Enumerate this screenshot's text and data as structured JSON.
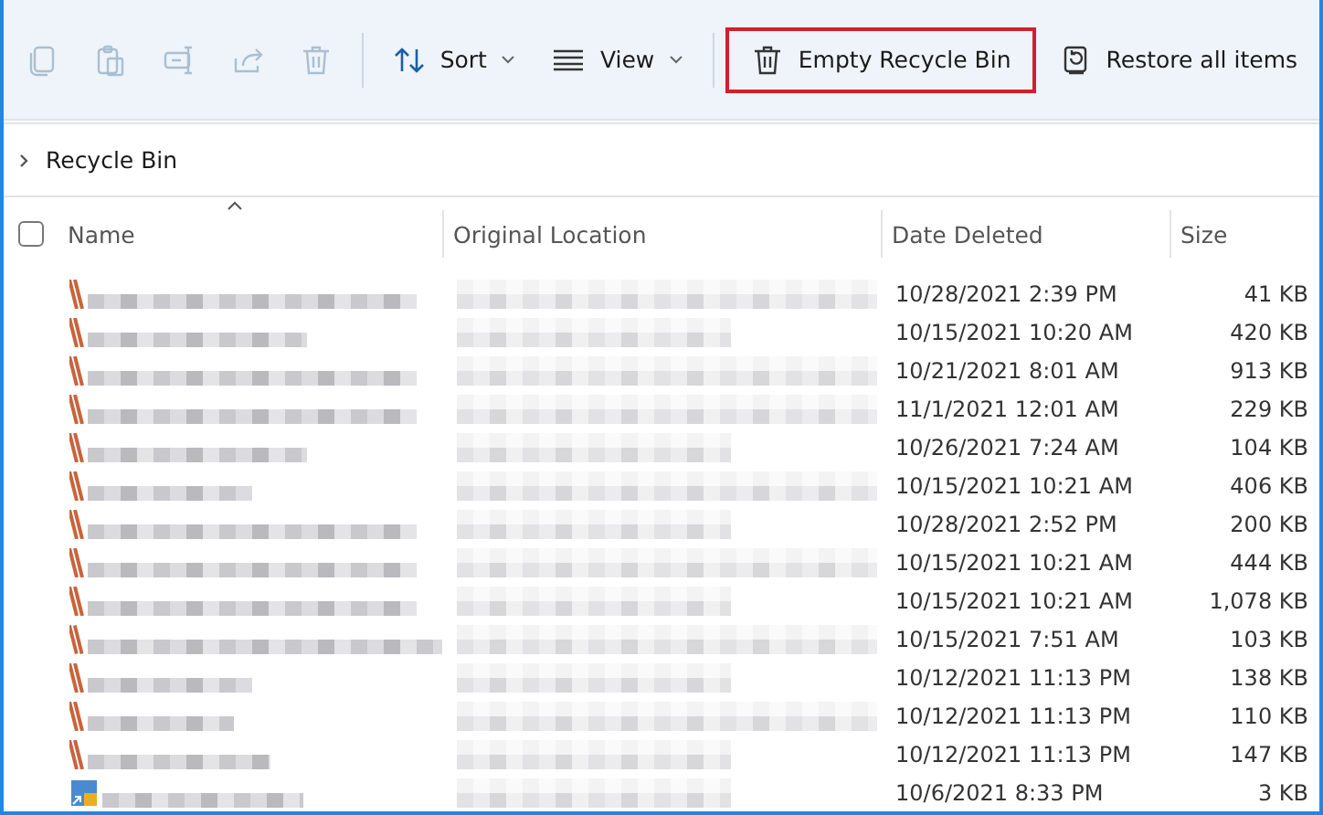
{
  "toolbar": {
    "icon_buttons": [
      {
        "kind": "copy",
        "disabled": true
      },
      {
        "kind": "paste",
        "disabled": true
      },
      {
        "kind": "rename",
        "disabled": true
      },
      {
        "kind": "share",
        "disabled": true
      },
      {
        "kind": "delete",
        "disabled": true
      }
    ],
    "sort": {
      "label": "Sort"
    },
    "view": {
      "label": "View"
    },
    "actions": [
      {
        "kind": "empty",
        "label": "Empty Recycle Bin",
        "highlighted": true
      },
      {
        "kind": "restore",
        "label": "Restore all items",
        "highlighted": false
      }
    ]
  },
  "breadcrumb": {
    "label": "Recycle Bin"
  },
  "table": {
    "select_all": {
      "checked": false
    },
    "columns": [
      {
        "label": "Name",
        "sorted": true
      },
      {
        "label": "Original Location",
        "sorted": false
      },
      {
        "label": "Date Deleted",
        "sorted": false
      },
      {
        "label": "Size",
        "sorted": false
      }
    ],
    "rows": [
      {
        "kind": "document",
        "date_deleted": "10/28/2021 2:39 PM",
        "size": "41 KB"
      },
      {
        "kind": "document",
        "date_deleted": "10/15/2021 10:20 AM",
        "size": "420 KB"
      },
      {
        "kind": "document",
        "date_deleted": "10/21/2021 8:01 AM",
        "size": "913 KB"
      },
      {
        "kind": "document",
        "date_deleted": "11/1/2021 12:01 AM",
        "size": "229 KB"
      },
      {
        "kind": "document",
        "date_deleted": "10/26/2021 7:24 AM",
        "size": "104 KB"
      },
      {
        "kind": "document",
        "date_deleted": "10/15/2021 10:21 AM",
        "size": "406 KB"
      },
      {
        "kind": "document",
        "date_deleted": "10/28/2021 2:52 PM",
        "size": "200 KB"
      },
      {
        "kind": "document",
        "date_deleted": "10/15/2021 10:21 AM",
        "size": "444 KB"
      },
      {
        "kind": "document",
        "date_deleted": "10/15/2021 10:21 AM",
        "size": "1,078 KB"
      },
      {
        "kind": "document",
        "date_deleted": "10/15/2021 7:51 AM",
        "size": "103 KB"
      },
      {
        "kind": "document",
        "date_deleted": "10/12/2021 11:13 PM",
        "size": "138 KB"
      },
      {
        "kind": "document",
        "date_deleted": "10/12/2021 11:13 PM",
        "size": "110 KB"
      },
      {
        "kind": "document",
        "date_deleted": "10/12/2021 11:13 PM",
        "size": "147 KB"
      },
      {
        "kind": "shortcut",
        "date_deleted": "10/6/2021 8:33 PM",
        "size": "3 KB"
      }
    ]
  }
}
